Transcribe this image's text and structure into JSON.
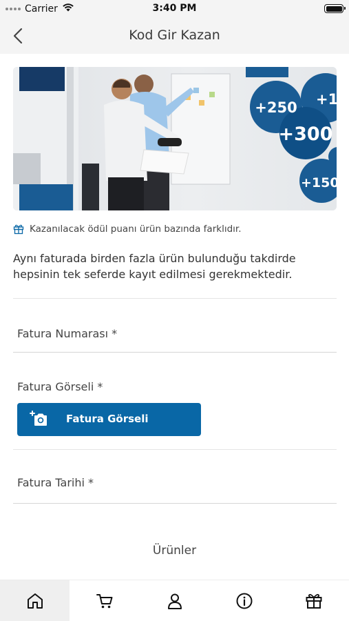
{
  "status_bar": {
    "carrier": "Carrier",
    "time": "3:40 PM"
  },
  "nav": {
    "title": "Kod Gir Kazan"
  },
  "banner": {
    "badges": [
      "+250",
      "+1(",
      "+300",
      "+150"
    ]
  },
  "note": {
    "text": "Kazanılacak ödül puanı ürün bazında farklıdır."
  },
  "description": "Aynı faturada birden fazla ürün bulunduğu takdirde hepsinin tek seferde kayıt edilmesi gerekmektedir.",
  "form": {
    "invoice_number_label": "Fatura Numarası *",
    "invoice_image_label": "Fatura Görseli *",
    "invoice_image_button": "Fatura Görseli",
    "invoice_date_label": "Fatura Tarihi *"
  },
  "products_label": "Ürünler",
  "tabs": [
    {
      "icon": "home-icon",
      "active": true
    },
    {
      "icon": "cart-icon",
      "active": false
    },
    {
      "icon": "user-icon",
      "active": false
    },
    {
      "icon": "info-icon",
      "active": false
    },
    {
      "icon": "gift-icon",
      "active": false
    }
  ],
  "colors": {
    "primary": "#0967a6",
    "badge_blue": "#1a5c94",
    "dark_navy": "#163a66"
  }
}
